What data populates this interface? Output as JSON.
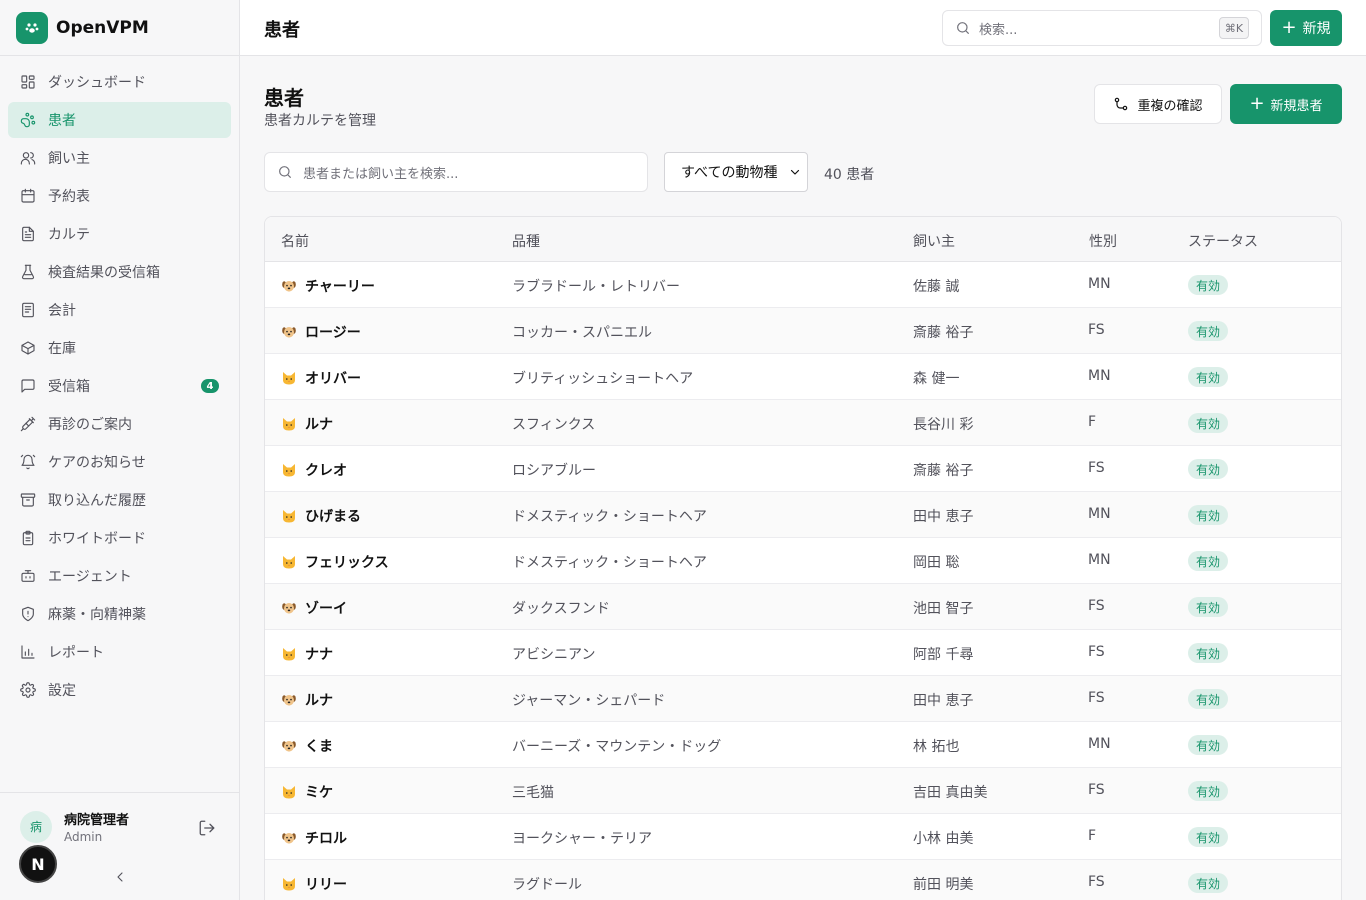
{
  "brand": {
    "name": "OpenVPM"
  },
  "colors": {
    "accent": "#17946b",
    "accent_soft": "#dcefe9"
  },
  "sidebar": {
    "items": [
      {
        "label": "ダッシュボード",
        "icon": "dashboard-icon"
      },
      {
        "label": "患者",
        "icon": "paw-icon",
        "active": true
      },
      {
        "label": "飼い主",
        "icon": "users-icon"
      },
      {
        "label": "予約表",
        "icon": "calendar-icon"
      },
      {
        "label": "カルテ",
        "icon": "file-text-icon"
      },
      {
        "label": "検査結果の受信箱",
        "icon": "flask-icon"
      },
      {
        "label": "会計",
        "icon": "receipt-icon"
      },
      {
        "label": "在庫",
        "icon": "package-icon"
      },
      {
        "label": "受信箱",
        "icon": "message-icon",
        "badge": "4"
      },
      {
        "label": "再診のご案内",
        "icon": "syringe-icon"
      },
      {
        "label": "ケアのお知らせ",
        "icon": "bell-icon"
      },
      {
        "label": "取り込んだ履歴",
        "icon": "archive-icon"
      },
      {
        "label": "ホワイトボード",
        "icon": "clipboard-icon"
      },
      {
        "label": "エージェント",
        "icon": "bot-icon"
      },
      {
        "label": "麻薬・向精神薬",
        "icon": "shield-icon"
      },
      {
        "label": "レポート",
        "icon": "bar-chart-icon"
      },
      {
        "label": "設定",
        "icon": "gear-icon"
      }
    ],
    "user": {
      "avatar": "病",
      "name": "病院管理者",
      "role": "Admin"
    },
    "n_badge": "N"
  },
  "topbar": {
    "title": "患者",
    "search_placeholder": "検索...",
    "shortcut": "⌘K",
    "new_label": "新規"
  },
  "page": {
    "title": "患者",
    "subtitle": "患者カルテを管理",
    "duplicates_label": "重複の確認",
    "new_patient_label": "新規患者",
    "search_placeholder": "患者または飼い主を検索...",
    "species_selected": "すべての動物種",
    "count_text": "40 患者"
  },
  "table": {
    "headers": [
      "名前",
      "品種",
      "飼い主",
      "性別",
      "ステータス"
    ],
    "rows": [
      {
        "species": "dog",
        "name": "チャーリー",
        "breed": "ラブラドール・レトリバー",
        "owner": "佐藤 誠",
        "sex": "MN",
        "status": "有効"
      },
      {
        "species": "dog",
        "name": "ロージー",
        "breed": "コッカー・スパニエル",
        "owner": "斎藤 裕子",
        "sex": "FS",
        "status": "有効"
      },
      {
        "species": "cat",
        "name": "オリバー",
        "breed": "ブリティッシュショートヘア",
        "owner": "森 健一",
        "sex": "MN",
        "status": "有効"
      },
      {
        "species": "cat",
        "name": "ルナ",
        "breed": "スフィンクス",
        "owner": "長谷川 彩",
        "sex": "F",
        "status": "有効"
      },
      {
        "species": "cat",
        "name": "クレオ",
        "breed": "ロシアブルー",
        "owner": "斎藤 裕子",
        "sex": "FS",
        "status": "有効"
      },
      {
        "species": "cat",
        "name": "ひげまる",
        "breed": "ドメスティック・ショートヘア",
        "owner": "田中 恵子",
        "sex": "MN",
        "status": "有効"
      },
      {
        "species": "cat",
        "name": "フェリックス",
        "breed": "ドメスティック・ショートヘア",
        "owner": "岡田 聡",
        "sex": "MN",
        "status": "有効"
      },
      {
        "species": "dog",
        "name": "ゾーイ",
        "breed": "ダックスフンド",
        "owner": "池田 智子",
        "sex": "FS",
        "status": "有効"
      },
      {
        "species": "cat",
        "name": "ナナ",
        "breed": "アビシニアン",
        "owner": "阿部 千尋",
        "sex": "FS",
        "status": "有効"
      },
      {
        "species": "dog",
        "name": "ルナ",
        "breed": "ジャーマン・シェパード",
        "owner": "田中 恵子",
        "sex": "FS",
        "status": "有効"
      },
      {
        "species": "dog",
        "name": "くま",
        "breed": "バーニーズ・マウンテン・ドッグ",
        "owner": "林 拓也",
        "sex": "MN",
        "status": "有効"
      },
      {
        "species": "cat",
        "name": "ミケ",
        "breed": "三毛猫",
        "owner": "吉田 真由美",
        "sex": "FS",
        "status": "有効"
      },
      {
        "species": "dog",
        "name": "チロル",
        "breed": "ヨークシャー・テリア",
        "owner": "小林 由美",
        "sex": "F",
        "status": "有効"
      },
      {
        "species": "cat",
        "name": "リリー",
        "breed": "ラグドール",
        "owner": "前田 明美",
        "sex": "FS",
        "status": "有効"
      }
    ]
  }
}
